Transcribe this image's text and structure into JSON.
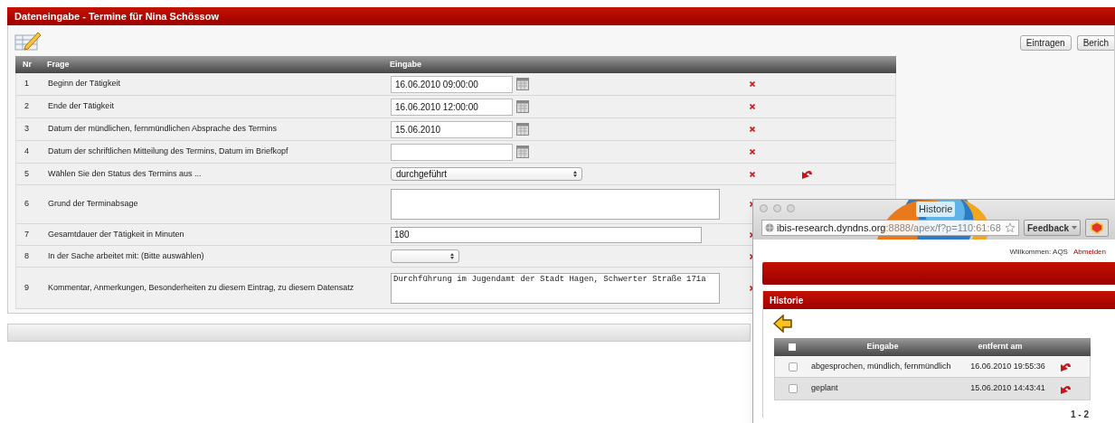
{
  "window": {
    "title": "Dateneingabe - Termine für Nina Schössow"
  },
  "toolbar": {
    "buttons": [
      "Eintragen",
      "Berich"
    ]
  },
  "table": {
    "columns": [
      "Nr",
      "Frage",
      "Eingabe"
    ],
    "rows": [
      {
        "nr": "1",
        "question": "Beginn der Tätigkeit",
        "kind": "date",
        "value": "16.06.2010 09:00:00",
        "revertible": false
      },
      {
        "nr": "2",
        "question": "Ende der Tätigkeit",
        "kind": "date",
        "value": "16.06.2010 12:00:00",
        "revertible": false
      },
      {
        "nr": "3",
        "question": "Datum der mündlichen, fernmündlichen Absprache des Termins",
        "kind": "date",
        "value": "15.06.2010",
        "revertible": false
      },
      {
        "nr": "4",
        "question": "Datum der schriftlichen Mitteilung des Termins, Datum im Briefkopf",
        "kind": "date",
        "revertible": false
      },
      {
        "nr": "5",
        "question": "Wählen Sie den Status des Termins aus ...",
        "kind": "select",
        "value": "durchgeführt",
        "revertible": true
      },
      {
        "nr": "6",
        "question": "Grund der Terminabsage",
        "kind": "textarea",
        "revertible": false
      },
      {
        "nr": "7",
        "question": "Gesamtdauer der Tätigkeit in Minuten",
        "kind": "text",
        "value": "180",
        "revertible": false
      },
      {
        "nr": "8",
        "question": "In der Sache arbeitet mit: (Bitte auswählen)",
        "kind": "select",
        "revertible": false
      },
      {
        "nr": "9",
        "question": "Kommentar, Anmerkungen, Besonderheiten zu diesem Eintrag, zu diesem Datensatz",
        "kind": "textarea",
        "value": "Durchführung im Jugendamt der Stadt Hagen, Schwerter Straße 171a",
        "revertible": false
      }
    ]
  },
  "popup": {
    "title": "Historie",
    "address": {
      "host": "ibis-research.dyndns.org",
      "rest": ":8888/apex/f?p=110:61:68"
    },
    "feedback_button": "Feedback",
    "welcome": "Willkommen: AQS",
    "logout": "Abmelden",
    "region_title": "Historie",
    "history": {
      "columns": [
        "Eingabe",
        "entfernt am"
      ],
      "header_checked": false,
      "rows": [
        {
          "value": "abgesprochen, mündlich, fernmündlich",
          "removed": "16.06.2010 19:55:36",
          "checked": false
        },
        {
          "value": "geplant",
          "removed": "15.06.2010 14:43:41",
          "checked": false
        }
      ],
      "pagination": "1 - 2"
    }
  }
}
